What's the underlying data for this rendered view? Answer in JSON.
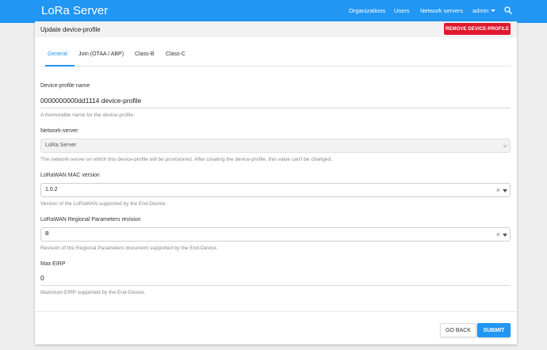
{
  "app": {
    "title": "LoRa Server"
  },
  "nav": {
    "organizations": "Organizations",
    "users": "Users",
    "network_servers": "Network servers",
    "user_menu": "admin"
  },
  "colors": {
    "primary": "#2196f3",
    "danger": "#e0182e"
  },
  "icons": {
    "search": "search-icon",
    "user_menu": "chevron-down-icon",
    "clear": "close-icon",
    "dropdown": "chevron-down-icon"
  },
  "card": {
    "title": "Update device-profile",
    "remove_label": "REMOVE DEVICE-PROFILE"
  },
  "tabs": [
    {
      "label": "General",
      "active": true
    },
    {
      "label": "Join (OTAA / ABP)",
      "active": false
    },
    {
      "label": "Class-B",
      "active": false
    },
    {
      "label": "Class-C",
      "active": false
    }
  ],
  "form": {
    "name": {
      "label": "Device-profile name",
      "value": "0000000000dd1114 device-profile",
      "hint": "A memorable name for the device-profile."
    },
    "network_server": {
      "label": "Network-server",
      "value": "LoRa Server",
      "hint": "The network-server on which this device-profile will be provisioned. After creating the device-profile, this value can't be changed."
    },
    "mac_version": {
      "label": "LoRaWAN MAC version",
      "value": "1.0.2",
      "hint": "Version of the LoRaWAN supported by the End-Device."
    },
    "reg_params": {
      "label": "LoRaWAN Regional Parameters revision",
      "value": "B",
      "hint": "Revision of the Regional Parameters document supported by the End-Device."
    },
    "max_eirp": {
      "label": "Max EIRP",
      "value": "0",
      "hint": "Maximum EIRP supported by the End-Device."
    }
  },
  "actions": {
    "go_back": "GO BACK",
    "submit": "SUBMIT"
  }
}
